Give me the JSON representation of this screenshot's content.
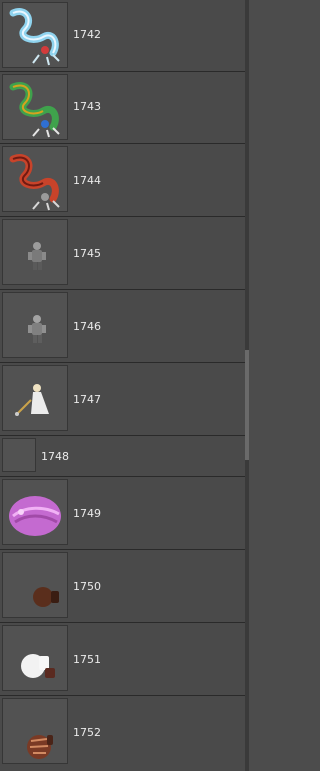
{
  "items": [
    {
      "id": "1742",
      "icon": "ice-serpent-icon"
    },
    {
      "id": "1743",
      "icon": "green-serpent-icon"
    },
    {
      "id": "1744",
      "icon": "red-serpent-icon"
    },
    {
      "id": "1745",
      "icon": "armored-soldier-icon"
    },
    {
      "id": "1746",
      "icon": "armored-soldier-icon"
    },
    {
      "id": "1747",
      "icon": "white-robed-mage-icon"
    },
    {
      "id": "1748",
      "icon": "empty-sprite"
    },
    {
      "id": "1749",
      "icon": "pink-blob-creature-icon"
    },
    {
      "id": "1750",
      "icon": "brown-sack-icon"
    },
    {
      "id": "1751",
      "icon": "white-sack-icon"
    },
    {
      "id": "1752",
      "icon": "striped-sack-icon"
    }
  ],
  "colors": {
    "background": "#4c4c4c",
    "row": "#4a4a4a",
    "text": "#eaeaea"
  }
}
